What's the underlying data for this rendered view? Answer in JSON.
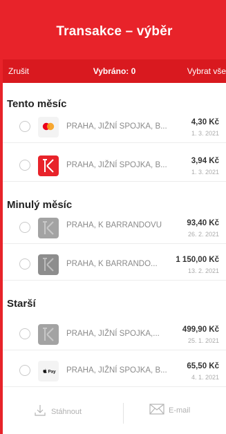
{
  "header": {
    "title": "Transakce – výběr"
  },
  "toolbar": {
    "cancel": "Zrušit",
    "selected": "Vybráno: 0",
    "select_all": "Vybrat vše"
  },
  "sections": [
    {
      "title": "Tento měsíc",
      "rows": [
        {
          "logo": "mastercard-logo",
          "merchant": "PRAHA, JIŽNÍ SPOJKA, B...",
          "amount": "4,30 Kč",
          "date": "1. 3. 2021"
        },
        {
          "logo": "tk-logo-red",
          "merchant": "PRAHA, JIŽNÍ SPOJKA, B...",
          "amount": "3,94 Kč",
          "date": "1. 3. 2021"
        }
      ]
    },
    {
      "title": "Minulý měsíc",
      "rows": [
        {
          "logo": "tk-logo-gray",
          "merchant": "PRAHA, K BARRANDOVU",
          "amount": "93,40 Kč",
          "date": "26. 2. 2021"
        },
        {
          "logo": "tk-logo-gray",
          "merchant": "PRAHA, K BARRANDO...",
          "amount": "1 150,00 Kč",
          "date": "13. 2. 2021"
        }
      ]
    },
    {
      "title": "Starší",
      "rows": [
        {
          "logo": "tk-logo-gray",
          "merchant": "PRAHA, JIŽNÍ SPOJKA,...",
          "amount": "499,90 Kč",
          "date": "25. 1. 2021"
        },
        {
          "logo": "apple-pay-logo",
          "merchant": "PRAHA, JIŽNÍ SPOJKA, B...",
          "amount": "65,50 Kč",
          "date": "4. 1. 2021"
        }
      ]
    }
  ],
  "footer": {
    "download": "Stáhnout",
    "email": "E-mail"
  },
  "colors": {
    "brand": "#e8232a",
    "toolbar": "#d9191f"
  }
}
